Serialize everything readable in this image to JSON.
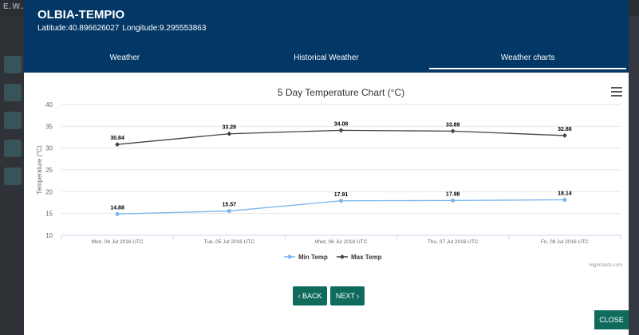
{
  "background": {
    "brand": "E.W.A.R.C."
  },
  "header": {
    "city": "OLBIA-TEMPIO",
    "latitude": "Latitude:40.896626027",
    "longitude": "Longitude:9.295553863"
  },
  "tabs": [
    {
      "label": "Weather"
    },
    {
      "label": "Historical Weather"
    },
    {
      "label": "Weather charts",
      "active": true
    }
  ],
  "buttons": {
    "back": "‹ BACK",
    "next": "NEXT ›",
    "close": "CLOSE"
  },
  "credit": "Highcharts.com",
  "colors": {
    "header": "#033766",
    "button": "#0f6b5c",
    "min_series": "#7cb5ec",
    "max_series": "#434348"
  },
  "chart_data": {
    "type": "line",
    "title": "5 Day Temperature Chart (°C)",
    "ylabel": "Temperature (°C)",
    "xlabel": "",
    "ylim": [
      10,
      40
    ],
    "yticks": [
      10,
      15,
      20,
      25,
      30,
      35,
      40
    ],
    "categories": [
      "Mon, 04 Jul 2016 UTC",
      "Tue, 05 Jul 2016 UTC",
      "Wed, 06 Jul 2016 UTC",
      "Thu, 07 Jul 2016 UTC",
      "Fri, 08 Jul 2016 UTC"
    ],
    "series": [
      {
        "name": "Min Temp",
        "values": [
          14.88,
          15.57,
          17.91,
          17.98,
          18.14
        ]
      },
      {
        "name": "Max Temp",
        "values": [
          30.84,
          33.28,
          34.08,
          33.89,
          32.88
        ]
      }
    ],
    "legend": "bottom-center",
    "grid": true
  }
}
